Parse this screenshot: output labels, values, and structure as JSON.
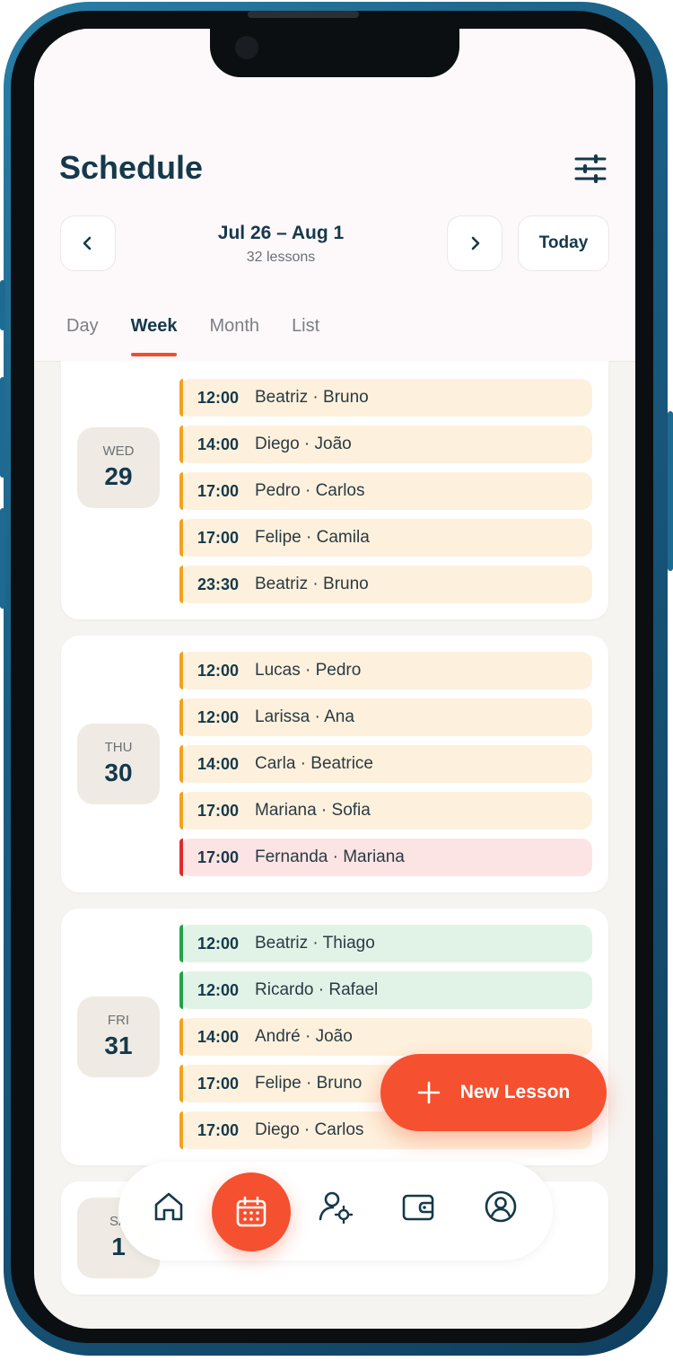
{
  "header": {
    "title": "Schedule",
    "range": "Jul 26 – Aug 1",
    "lessons_count": "32 lessons",
    "today_label": "Today",
    "prev_icon": "chevron-left-icon",
    "next_icon": "chevron-right-icon",
    "filter_icon": "sliders-icon"
  },
  "tabs": [
    {
      "label": "Day",
      "active": false
    },
    {
      "label": "Week",
      "active": true
    },
    {
      "label": "Month",
      "active": false
    },
    {
      "label": "List",
      "active": false
    }
  ],
  "days": [
    {
      "dow": "WED",
      "day": "29",
      "lessons": [
        {
          "time": "12:00",
          "who": "Beatriz · Bruno",
          "status": "amber"
        },
        {
          "time": "14:00",
          "who": "Diego · João",
          "status": "amber"
        },
        {
          "time": "17:00",
          "who": "Pedro · Carlos",
          "status": "amber"
        },
        {
          "time": "17:00",
          "who": "Felipe · Camila",
          "status": "amber"
        },
        {
          "time": "23:30",
          "who": "Beatriz · Bruno",
          "status": "amber"
        }
      ]
    },
    {
      "dow": "THU",
      "day": "30",
      "lessons": [
        {
          "time": "12:00",
          "who": "Lucas · Pedro",
          "status": "amber"
        },
        {
          "time": "12:00",
          "who": "Larissa · Ana",
          "status": "amber"
        },
        {
          "time": "14:00",
          "who": "Carla · Beatrice",
          "status": "amber"
        },
        {
          "time": "17:00",
          "who": "Mariana · Sofia",
          "status": "amber"
        },
        {
          "time": "17:00",
          "who": "Fernanda · Mariana",
          "status": "red"
        }
      ]
    },
    {
      "dow": "FRI",
      "day": "31",
      "lessons": [
        {
          "time": "12:00",
          "who": "Beatriz · Thiago",
          "status": "green"
        },
        {
          "time": "12:00",
          "who": "Ricardo · Rafael",
          "status": "green"
        },
        {
          "time": "14:00",
          "who": "André · João",
          "status": "amber"
        },
        {
          "time": "17:00",
          "who": "Felipe · Bruno",
          "status": "amber"
        },
        {
          "time": "17:00",
          "who": "Diego · Carlos",
          "status": "amber"
        }
      ]
    },
    {
      "dow": "SA",
      "day": "1",
      "lessons": []
    }
  ],
  "fab": {
    "label": "New Lesson",
    "icon": "plus-icon"
  },
  "bottom_nav": [
    "home-icon",
    "calendar-icon",
    "user-settings-icon",
    "wallet-icon",
    "profile-icon"
  ],
  "colors": {
    "accent": "#f5502f",
    "amber": "#f3a11f",
    "red": "#e02b2b",
    "green": "#22a249",
    "ink": "#15394a"
  }
}
